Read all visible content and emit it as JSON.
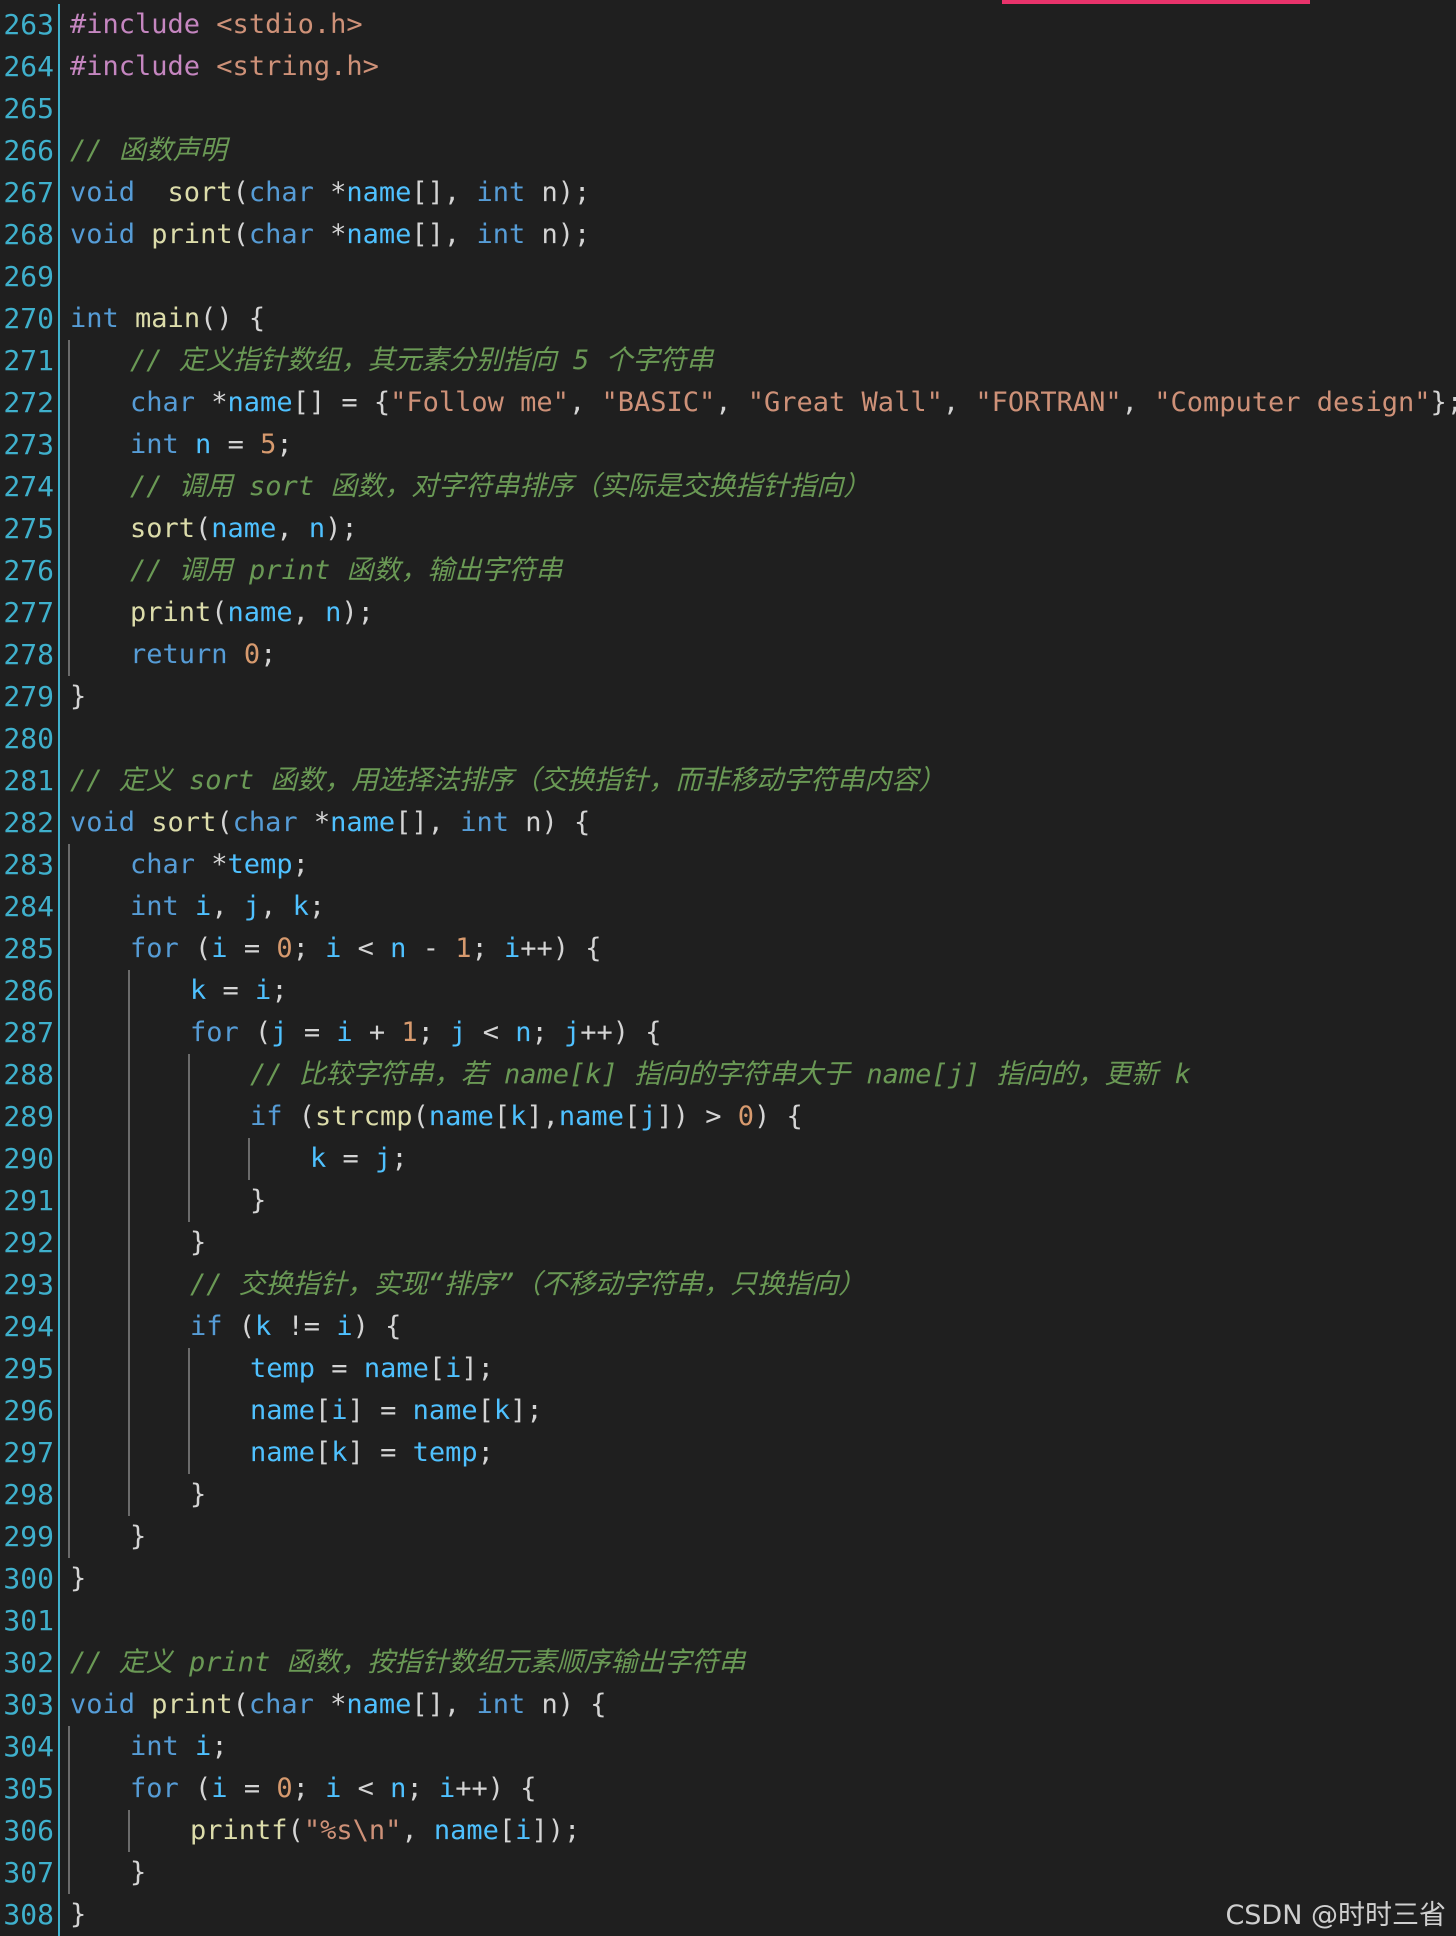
{
  "editor": {
    "lines": [
      {
        "no": "263",
        "indent": 0,
        "tokens": [
          [
            "pp",
            "#include"
          ],
          [
            "str",
            " <stdio.h>"
          ]
        ]
      },
      {
        "no": "264",
        "indent": 0,
        "tokens": [
          [
            "pp",
            "#include"
          ],
          [
            "str",
            " <string.h>"
          ]
        ]
      },
      {
        "no": "265",
        "indent": 0,
        "tokens": []
      },
      {
        "no": "266",
        "indent": 0,
        "tokens": [
          [
            "cm",
            "// 函数声明"
          ]
        ]
      },
      {
        "no": "267",
        "indent": 0,
        "tokens": [
          [
            "kw",
            "void"
          ],
          [
            "",
            "  "
          ],
          [
            "fn",
            "sort"
          ],
          [
            "",
            "("
          ],
          [
            "kw",
            "char"
          ],
          [
            "",
            " *"
          ],
          [
            "var",
            "name"
          ],
          [
            "",
            "[], "
          ],
          [
            "kw",
            "int"
          ],
          [
            "",
            " n);"
          ]
        ]
      },
      {
        "no": "268",
        "indent": 0,
        "tokens": [
          [
            "kw",
            "void"
          ],
          [
            "",
            " "
          ],
          [
            "fn",
            "print"
          ],
          [
            "",
            "("
          ],
          [
            "kw",
            "char"
          ],
          [
            "",
            " *"
          ],
          [
            "var",
            "name"
          ],
          [
            "",
            "[], "
          ],
          [
            "kw",
            "int"
          ],
          [
            "",
            " n);"
          ]
        ]
      },
      {
        "no": "269",
        "indent": 0,
        "tokens": []
      },
      {
        "no": "270",
        "indent": 0,
        "tokens": [
          [
            "kw",
            "int"
          ],
          [
            "",
            " "
          ],
          [
            "fn",
            "main"
          ],
          [
            "",
            "() {"
          ]
        ]
      },
      {
        "no": "271",
        "indent": 1,
        "tokens": [
          [
            "cm",
            "// 定义指针数组，其元素分别指向 5 个字符串"
          ]
        ]
      },
      {
        "no": "272",
        "indent": 1,
        "tokens": [
          [
            "kw",
            "char"
          ],
          [
            "",
            " *"
          ],
          [
            "var",
            "name"
          ],
          [
            "",
            "[] = {"
          ],
          [
            "str",
            "\"Follow me\""
          ],
          [
            "",
            ", "
          ],
          [
            "str",
            "\"BASIC\""
          ],
          [
            "",
            ", "
          ],
          [
            "str",
            "\"Great Wall\""
          ],
          [
            "",
            ", "
          ],
          [
            "str",
            "\"FORTRAN\""
          ],
          [
            "",
            ", "
          ],
          [
            "str",
            "\"Computer design\""
          ],
          [
            "",
            "};"
          ]
        ]
      },
      {
        "no": "273",
        "indent": 1,
        "tokens": [
          [
            "kw",
            "int"
          ],
          [
            "",
            " "
          ],
          [
            "var",
            "n"
          ],
          [
            "",
            " = "
          ],
          [
            "num",
            "5"
          ],
          [
            "",
            ";"
          ]
        ]
      },
      {
        "no": "274",
        "indent": 1,
        "tokens": [
          [
            "cm",
            "// 调用 sort 函数，对字符串排序（实际是交换指针指向）"
          ]
        ]
      },
      {
        "no": "275",
        "indent": 1,
        "tokens": [
          [
            "fn",
            "sort"
          ],
          [
            "",
            "("
          ],
          [
            "var",
            "name"
          ],
          [
            "",
            ", "
          ],
          [
            "var",
            "n"
          ],
          [
            "",
            ");"
          ]
        ]
      },
      {
        "no": "276",
        "indent": 1,
        "tokens": [
          [
            "cm",
            "// 调用 print 函数，输出字符串"
          ]
        ]
      },
      {
        "no": "277",
        "indent": 1,
        "tokens": [
          [
            "fn",
            "print"
          ],
          [
            "",
            "("
          ],
          [
            "var",
            "name"
          ],
          [
            "",
            ", "
          ],
          [
            "var",
            "n"
          ],
          [
            "",
            ");"
          ]
        ]
      },
      {
        "no": "278",
        "indent": 1,
        "tokens": [
          [
            "kw",
            "return"
          ],
          [
            "",
            " "
          ],
          [
            "num",
            "0"
          ],
          [
            "",
            ";"
          ]
        ]
      },
      {
        "no": "279",
        "indent": 0,
        "tokens": [
          [
            "",
            "}"
          ]
        ]
      },
      {
        "no": "280",
        "indent": 0,
        "tokens": []
      },
      {
        "no": "281",
        "indent": 0,
        "tokens": [
          [
            "cm",
            "// 定义 sort 函数，用选择法排序（交换指针，而非移动字符串内容）"
          ]
        ]
      },
      {
        "no": "282",
        "indent": 0,
        "tokens": [
          [
            "kw",
            "void"
          ],
          [
            "",
            " "
          ],
          [
            "fn",
            "sort"
          ],
          [
            "",
            "("
          ],
          [
            "kw",
            "char"
          ],
          [
            "",
            " *"
          ],
          [
            "var",
            "name"
          ],
          [
            "",
            "[], "
          ],
          [
            "kw",
            "int"
          ],
          [
            "",
            " n) {"
          ]
        ]
      },
      {
        "no": "283",
        "indent": 1,
        "tokens": [
          [
            "kw",
            "char"
          ],
          [
            "",
            " *"
          ],
          [
            "var",
            "temp"
          ],
          [
            "",
            ";"
          ]
        ]
      },
      {
        "no": "284",
        "indent": 1,
        "tokens": [
          [
            "kw",
            "int"
          ],
          [
            "",
            " "
          ],
          [
            "var",
            "i"
          ],
          [
            "",
            ", "
          ],
          [
            "var",
            "j"
          ],
          [
            "",
            ", "
          ],
          [
            "var",
            "k"
          ],
          [
            "",
            ";"
          ]
        ]
      },
      {
        "no": "285",
        "indent": 1,
        "tokens": [
          [
            "kw",
            "for"
          ],
          [
            "",
            " ("
          ],
          [
            "var",
            "i"
          ],
          [
            "",
            " = "
          ],
          [
            "num",
            "0"
          ],
          [
            "",
            "; "
          ],
          [
            "var",
            "i"
          ],
          [
            "",
            " < "
          ],
          [
            "var",
            "n"
          ],
          [
            "",
            " - "
          ],
          [
            "num",
            "1"
          ],
          [
            "",
            "; "
          ],
          [
            "var",
            "i"
          ],
          [
            "",
            "++) {"
          ]
        ]
      },
      {
        "no": "286",
        "indent": 2,
        "tokens": [
          [
            "var",
            "k"
          ],
          [
            "",
            " = "
          ],
          [
            "var",
            "i"
          ],
          [
            "",
            ";"
          ]
        ]
      },
      {
        "no": "287",
        "indent": 2,
        "tokens": [
          [
            "kw",
            "for"
          ],
          [
            "",
            " ("
          ],
          [
            "var",
            "j"
          ],
          [
            "",
            " = "
          ],
          [
            "var",
            "i"
          ],
          [
            "",
            " + "
          ],
          [
            "num",
            "1"
          ],
          [
            "",
            "; "
          ],
          [
            "var",
            "j"
          ],
          [
            "",
            " < "
          ],
          [
            "var",
            "n"
          ],
          [
            "",
            "; "
          ],
          [
            "var",
            "j"
          ],
          [
            "",
            "++) {"
          ]
        ]
      },
      {
        "no": "288",
        "indent": 3,
        "tokens": [
          [
            "cm",
            "// 比较字符串，若 name[k] 指向的字符串大于 name[j] 指向的，更新 k"
          ]
        ]
      },
      {
        "no": "289",
        "indent": 3,
        "tokens": [
          [
            "kw",
            "if"
          ],
          [
            "",
            " ("
          ],
          [
            "fn",
            "strcmp"
          ],
          [
            "",
            "("
          ],
          [
            "var",
            "name"
          ],
          [
            "",
            "["
          ],
          [
            "var",
            "k"
          ],
          [
            "",
            "],"
          ],
          [
            "var",
            "name"
          ],
          [
            "",
            "["
          ],
          [
            "var",
            "j"
          ],
          [
            "",
            "]) > "
          ],
          [
            "num",
            "0"
          ],
          [
            "",
            ") {"
          ]
        ]
      },
      {
        "no": "290",
        "indent": 4,
        "tokens": [
          [
            "var",
            "k"
          ],
          [
            "",
            " = "
          ],
          [
            "var",
            "j"
          ],
          [
            "",
            ";"
          ]
        ]
      },
      {
        "no": "291",
        "indent": 3,
        "tokens": [
          [
            "",
            "}"
          ]
        ]
      },
      {
        "no": "292",
        "indent": 2,
        "tokens": [
          [
            "",
            "}"
          ]
        ]
      },
      {
        "no": "293",
        "indent": 2,
        "tokens": [
          [
            "cm",
            "// 交换指针，实现“排序”（不移动字符串，只换指向）"
          ]
        ]
      },
      {
        "no": "294",
        "indent": 2,
        "tokens": [
          [
            "kw",
            "if"
          ],
          [
            "",
            " ("
          ],
          [
            "var",
            "k"
          ],
          [
            "",
            " != "
          ],
          [
            "var",
            "i"
          ],
          [
            "",
            ") {"
          ]
        ]
      },
      {
        "no": "295",
        "indent": 3,
        "tokens": [
          [
            "var",
            "temp"
          ],
          [
            "",
            " = "
          ],
          [
            "var",
            "name"
          ],
          [
            "",
            "["
          ],
          [
            "var",
            "i"
          ],
          [
            "",
            "];"
          ]
        ]
      },
      {
        "no": "296",
        "indent": 3,
        "tokens": [
          [
            "var",
            "name"
          ],
          [
            "",
            "["
          ],
          [
            "var",
            "i"
          ],
          [
            "",
            "] = "
          ],
          [
            "var",
            "name"
          ],
          [
            "",
            "["
          ],
          [
            "var",
            "k"
          ],
          [
            "",
            "];"
          ]
        ]
      },
      {
        "no": "297",
        "indent": 3,
        "tokens": [
          [
            "var",
            "name"
          ],
          [
            "",
            "["
          ],
          [
            "var",
            "k"
          ],
          [
            "",
            "] = "
          ],
          [
            "var",
            "temp"
          ],
          [
            "",
            ";"
          ]
        ]
      },
      {
        "no": "298",
        "indent": 2,
        "tokens": [
          [
            "",
            "}"
          ]
        ]
      },
      {
        "no": "299",
        "indent": 1,
        "tokens": [
          [
            "",
            "}"
          ]
        ]
      },
      {
        "no": "300",
        "indent": 0,
        "tokens": [
          [
            "",
            "}"
          ]
        ]
      },
      {
        "no": "301",
        "indent": 0,
        "tokens": []
      },
      {
        "no": "302",
        "indent": 0,
        "tokens": [
          [
            "cm",
            "// 定义 print 函数，按指针数组元素顺序输出字符串"
          ]
        ]
      },
      {
        "no": "303",
        "indent": 0,
        "tokens": [
          [
            "kw",
            "void"
          ],
          [
            "",
            " "
          ],
          [
            "fn",
            "print"
          ],
          [
            "",
            "("
          ],
          [
            "kw",
            "char"
          ],
          [
            "",
            " *"
          ],
          [
            "var",
            "name"
          ],
          [
            "",
            "[], "
          ],
          [
            "kw",
            "int"
          ],
          [
            "",
            " n) {"
          ]
        ]
      },
      {
        "no": "304",
        "indent": 1,
        "tokens": [
          [
            "kw",
            "int"
          ],
          [
            "",
            " "
          ],
          [
            "var",
            "i"
          ],
          [
            "",
            ";"
          ]
        ]
      },
      {
        "no": "305",
        "indent": 1,
        "tokens": [
          [
            "kw",
            "for"
          ],
          [
            "",
            " ("
          ],
          [
            "var",
            "i"
          ],
          [
            "",
            " = "
          ],
          [
            "num",
            "0"
          ],
          [
            "",
            "; "
          ],
          [
            "var",
            "i"
          ],
          [
            "",
            " < "
          ],
          [
            "var",
            "n"
          ],
          [
            "",
            "; "
          ],
          [
            "var",
            "i"
          ],
          [
            "",
            "++) {"
          ]
        ]
      },
      {
        "no": "306",
        "indent": 2,
        "tokens": [
          [
            "fn",
            "printf"
          ],
          [
            "",
            "("
          ],
          [
            "str",
            "\"%s\\n\""
          ],
          [
            "",
            ", "
          ],
          [
            "var",
            "name"
          ],
          [
            "",
            "["
          ],
          [
            "var",
            "i"
          ],
          [
            "",
            "]);"
          ]
        ]
      },
      {
        "no": "307",
        "indent": 1,
        "tokens": [
          [
            "",
            "}"
          ]
        ]
      },
      {
        "no": "308",
        "indent": 0,
        "tokens": [
          [
            "",
            "}"
          ]
        ]
      }
    ]
  },
  "watermark": "CSDN @时时三省"
}
